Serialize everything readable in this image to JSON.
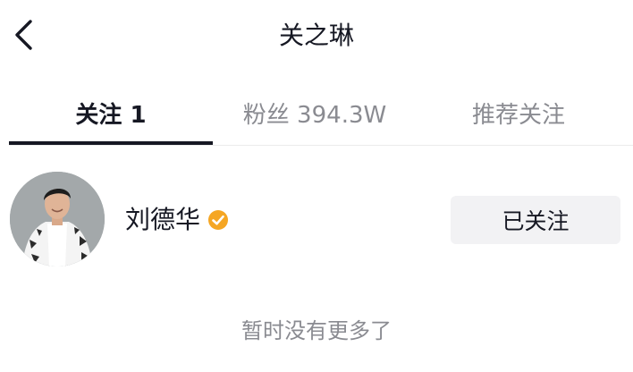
{
  "header": {
    "back_icon": "chevron-left-icon",
    "title": "关之琳"
  },
  "tabs": [
    {
      "label": "关注 1",
      "active": true
    },
    {
      "label": "粉丝 394.3W",
      "active": false
    },
    {
      "label": "推荐关注",
      "active": false
    }
  ],
  "user": {
    "name": "刘德华",
    "verified": true,
    "verified_icon": "verified-badge-icon",
    "verified_color": "#f5a623",
    "follow_button_label": "已关注"
  },
  "footer": {
    "no_more_text": "暂时没有更多了"
  }
}
